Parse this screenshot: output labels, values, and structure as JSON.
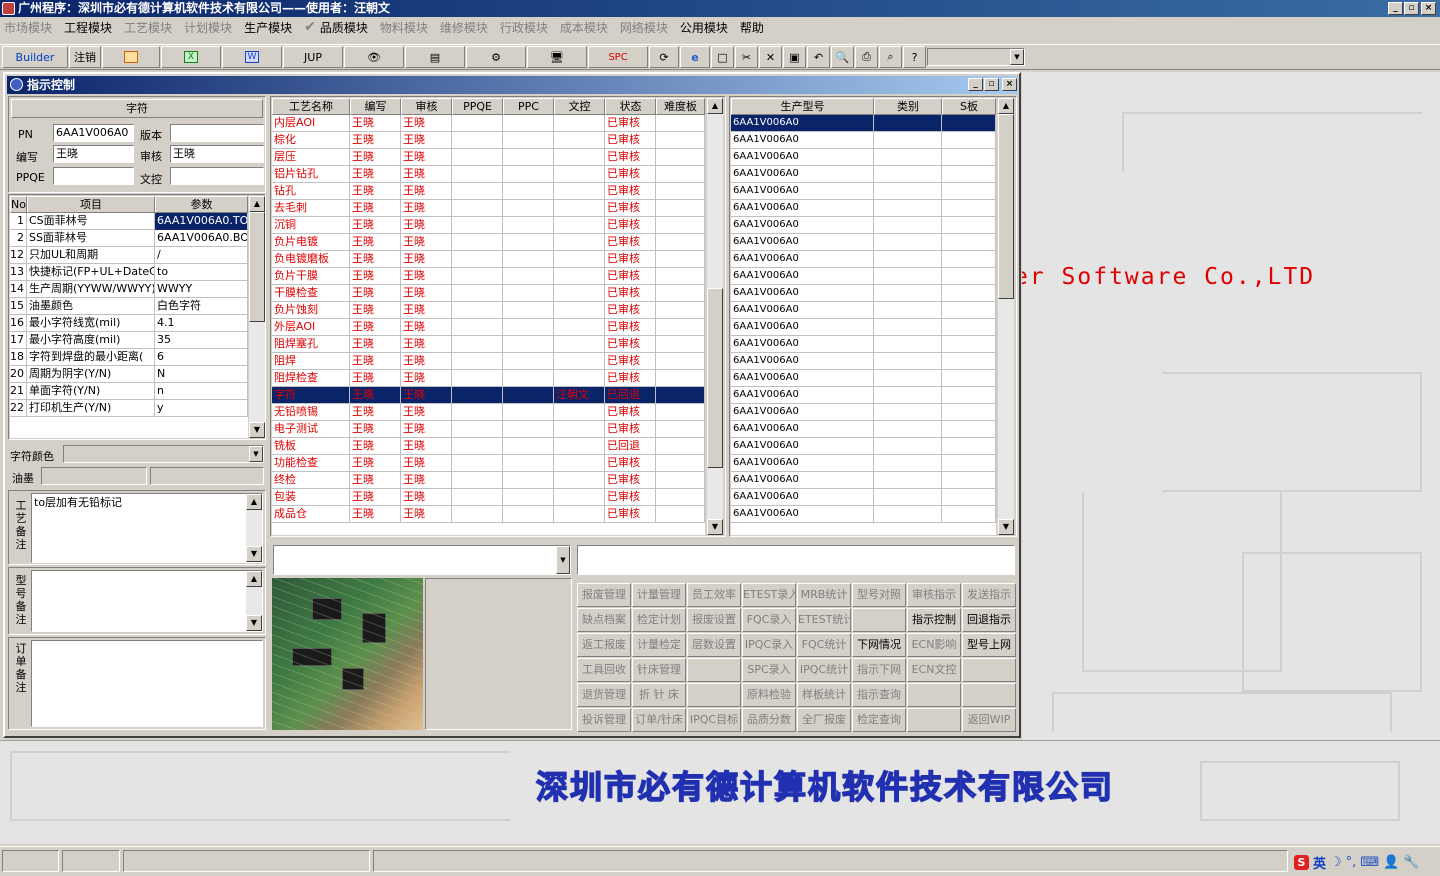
{
  "app": {
    "title": "广州程序：深圳市必有德计算机软件技术有限公司——使用者：汪朝文",
    "win_buttons": [
      "_",
      "▫",
      "×"
    ]
  },
  "menu": [
    {
      "label": "市场模块",
      "on": false
    },
    {
      "label": "工程模块",
      "on": true
    },
    {
      "label": "工艺模块",
      "on": false
    },
    {
      "label": "计划模块",
      "on": false
    },
    {
      "label": "生产模块",
      "on": true
    },
    {
      "label": "品质模块",
      "on": true
    },
    {
      "label": "物料模块",
      "on": false
    },
    {
      "label": "维修模块",
      "on": false
    },
    {
      "label": "行政模块",
      "on": false
    },
    {
      "label": "成本模块",
      "on": false
    },
    {
      "label": "网络模块",
      "on": false
    },
    {
      "label": "公用模块",
      "on": true
    },
    {
      "label": "帮助",
      "on": true
    }
  ],
  "toolbar": {
    "builder": "Builder",
    "logout": "注销",
    "jup": "JUP",
    "spc": "SPC"
  },
  "window": {
    "title": "指示控制"
  },
  "left": {
    "section": "字符",
    "pn_label": "PN",
    "pn_value": "6AA1V006A0",
    "version_label": "版本",
    "version_value": "",
    "editor_label": "编写",
    "editor_value": "王晓",
    "review_label": "审核",
    "review_value": "王晓",
    "ppqe_label": "PPQE",
    "ppqe_value": "",
    "doc_label": "文控",
    "doc_value": "",
    "params_headers": [
      "No",
      "项目",
      "参数"
    ],
    "params": [
      {
        "no": "1",
        "item": "CS面菲林号",
        "value": "6AA1V006A0.TO"
      },
      {
        "no": "2",
        "item": "SS面菲林号",
        "value": "6AA1V006A0.BO"
      },
      {
        "no": "12",
        "item": "只加UL和周期",
        "value": "/"
      },
      {
        "no": "13",
        "item": "快捷标记(FP+UL+DateCo",
        "value": "to"
      },
      {
        "no": "14",
        "item": "生产周期(YYWW/WWYY)",
        "value": "WWYY"
      },
      {
        "no": "15",
        "item": "油墨颜色",
        "value": "白色字符"
      },
      {
        "no": "16",
        "item": "最小字符线宽(mil)",
        "value": "4.1"
      },
      {
        "no": "17",
        "item": "最小字符高度(mil)",
        "value": "35"
      },
      {
        "no": "18",
        "item": "字符到焊盘的最小距离(",
        "value": "6"
      },
      {
        "no": "20",
        "item": "周期为阴字(Y/N)",
        "value": "N"
      },
      {
        "no": "21",
        "item": "单面字符(Y/N)",
        "value": "n"
      },
      {
        "no": "22",
        "item": "打印机生产(Y/N)",
        "value": "y"
      }
    ],
    "char_color_label": "字符颜色",
    "ink_label": "油墨",
    "process_note_label": "工艺备注",
    "process_note": "to层加有无铅标记",
    "model_note_label": "型号备注",
    "order_note_label": "订单备注"
  },
  "process": {
    "headers": [
      "工艺名称",
      "编写",
      "审核",
      "PPQE",
      "PPC",
      "文控",
      "状态",
      "难度板"
    ],
    "rows": [
      {
        "name": "内层AOI",
        "writer": "王晓",
        "reviewer": "王晓",
        "doc": "",
        "status": "已审核"
      },
      {
        "name": "棕化",
        "writer": "王晓",
        "reviewer": "王晓",
        "doc": "",
        "status": "已审核"
      },
      {
        "name": "层压",
        "writer": "王晓",
        "reviewer": "王晓",
        "doc": "",
        "status": "已审核"
      },
      {
        "name": "铝片钻孔",
        "writer": "王晓",
        "reviewer": "王晓",
        "doc": "",
        "status": "已审核"
      },
      {
        "name": "钻孔",
        "writer": "王晓",
        "reviewer": "王晓",
        "doc": "",
        "status": "已审核"
      },
      {
        "name": "去毛刺",
        "writer": "王晓",
        "reviewer": "王晓",
        "doc": "",
        "status": "已审核"
      },
      {
        "name": "沉铜",
        "writer": "王晓",
        "reviewer": "王晓",
        "doc": "",
        "status": "已审核"
      },
      {
        "name": "负片电镀",
        "writer": "王晓",
        "reviewer": "王晓",
        "doc": "",
        "status": "已审核"
      },
      {
        "name": "负电镀磨板",
        "writer": "王晓",
        "reviewer": "王晓",
        "doc": "",
        "status": "已审核"
      },
      {
        "name": "负片干膜",
        "writer": "王晓",
        "reviewer": "王晓",
        "doc": "",
        "status": "已审核"
      },
      {
        "name": "干膜检查",
        "writer": "王晓",
        "reviewer": "王晓",
        "doc": "",
        "status": "已审核"
      },
      {
        "name": "负片蚀刻",
        "writer": "王晓",
        "reviewer": "王晓",
        "doc": "",
        "status": "已审核"
      },
      {
        "name": "外层AOI",
        "writer": "王晓",
        "reviewer": "王晓",
        "doc": "",
        "status": "已审核"
      },
      {
        "name": "阻焊塞孔",
        "writer": "王晓",
        "reviewer": "王晓",
        "doc": "",
        "status": "已审核"
      },
      {
        "name": "阻焊",
        "writer": "王晓",
        "reviewer": "王晓",
        "doc": "",
        "status": "已审核"
      },
      {
        "name": "阻焊检查",
        "writer": "王晓",
        "reviewer": "王晓",
        "doc": "",
        "status": "已审核"
      },
      {
        "name": "字符",
        "writer": "王晓",
        "reviewer": "王晓",
        "doc": "汪朝文",
        "status": "已回退"
      },
      {
        "name": "无铅喷锡",
        "writer": "王晓",
        "reviewer": "王晓",
        "doc": "",
        "status": "已审核"
      },
      {
        "name": "电子测试",
        "writer": "王晓",
        "reviewer": "王晓",
        "doc": "",
        "status": "已审核"
      },
      {
        "name": "铣板",
        "writer": "王晓",
        "reviewer": "王晓",
        "doc": "",
        "status": "已回退"
      },
      {
        "name": "功能检查",
        "writer": "王晓",
        "reviewer": "王晓",
        "doc": "",
        "status": "已审核"
      },
      {
        "name": "终检",
        "writer": "王晓",
        "reviewer": "王晓",
        "doc": "",
        "status": "已审核"
      },
      {
        "name": "包装",
        "writer": "王晓",
        "reviewer": "王晓",
        "doc": "",
        "status": "已审核"
      },
      {
        "name": "成品仓",
        "writer": "王晓",
        "reviewer": "王晓",
        "doc": "",
        "status": "已审核"
      }
    ]
  },
  "models": {
    "headers": [
      "生产型号",
      "类别",
      "S板"
    ],
    "rows": [
      "6AA1V006A0",
      "6AA1V006A0",
      "6AA1V006A0",
      "6AA1V006A0",
      "6AA1V006A0",
      "6AA1V006A0",
      "6AA1V006A0",
      "6AA1V006A0",
      "6AA1V006A0",
      "6AA1V006A0",
      "6AA1V006A0",
      "6AA1V006A0",
      "6AA1V006A0",
      "6AA1V006A0",
      "6AA1V006A0",
      "6AA1V006A0",
      "6AA1V006A0",
      "6AA1V006A0",
      "6AA1V006A0",
      "6AA1V006A0",
      "6AA1V006A0",
      "6AA1V006A0",
      "6AA1V006A0",
      "6AA1V006A0"
    ]
  },
  "buttons": [
    [
      {
        "label": "报废管理",
        "on": false
      },
      {
        "label": "计量管理",
        "on": false
      },
      {
        "label": "员工效率",
        "on": false
      },
      {
        "label": "ETEST录入",
        "on": false
      },
      {
        "label": "MRB统计",
        "on": false
      },
      {
        "label": "型号对照",
        "on": false
      },
      {
        "label": "审核指示",
        "on": false
      },
      {
        "label": "发送指示",
        "on": false
      }
    ],
    [
      {
        "label": "缺点档案",
        "on": false
      },
      {
        "label": "检定计划",
        "on": false
      },
      {
        "label": "报废设置",
        "on": false
      },
      {
        "label": "FQC录入",
        "on": false
      },
      {
        "label": "ETEST统计",
        "on": false
      },
      {
        "label": "",
        "on": false
      },
      {
        "label": "指示控制",
        "on": true
      },
      {
        "label": "回退指示",
        "on": true
      }
    ],
    [
      {
        "label": "返工报废",
        "on": false
      },
      {
        "label": "计量检定",
        "on": false
      },
      {
        "label": "层数设置",
        "on": false
      },
      {
        "label": "IPQC录入",
        "on": false
      },
      {
        "label": "FQC统计",
        "on": false
      },
      {
        "label": "下网情况",
        "on": true
      },
      {
        "label": "ECN影响",
        "on": false
      },
      {
        "label": "型号上网",
        "on": true
      }
    ],
    [
      {
        "label": "工具回收",
        "on": false
      },
      {
        "label": "针床管理",
        "on": false
      },
      {
        "label": "",
        "on": false
      },
      {
        "label": "SPC录入",
        "on": false
      },
      {
        "label": "IPQC统计",
        "on": false
      },
      {
        "label": "指示下网",
        "on": false
      },
      {
        "label": "ECN文控",
        "on": false
      },
      {
        "label": "",
        "on": false
      }
    ],
    [
      {
        "label": "退货管理",
        "on": false
      },
      {
        "label": "折 针 床",
        "on": false
      },
      {
        "label": "",
        "on": false
      },
      {
        "label": "原料检验",
        "on": false
      },
      {
        "label": "样板统计",
        "on": false
      },
      {
        "label": "指示查询",
        "on": false
      },
      {
        "label": "",
        "on": false
      },
      {
        "label": "",
        "on": false
      }
    ],
    [
      {
        "label": "投诉管理",
        "on": false
      },
      {
        "label": "订单/针床",
        "on": false
      },
      {
        "label": "IPQC目标",
        "on": false
      },
      {
        "label": "品质分数",
        "on": false
      },
      {
        "label": "全厂报废",
        "on": false
      },
      {
        "label": "检定查询",
        "on": false
      },
      {
        "label": "",
        "on": false
      },
      {
        "label": "返回WIP",
        "on": false
      }
    ]
  ],
  "desktop": {
    "software_text": "er Software Co.,LTD",
    "company": "深圳市必有德计算机软件技术有限公司"
  },
  "tray": {
    "ime": "英"
  },
  "colors": {
    "red": "#e00000",
    "title": "#0a246a",
    "select": "#0a246a"
  }
}
